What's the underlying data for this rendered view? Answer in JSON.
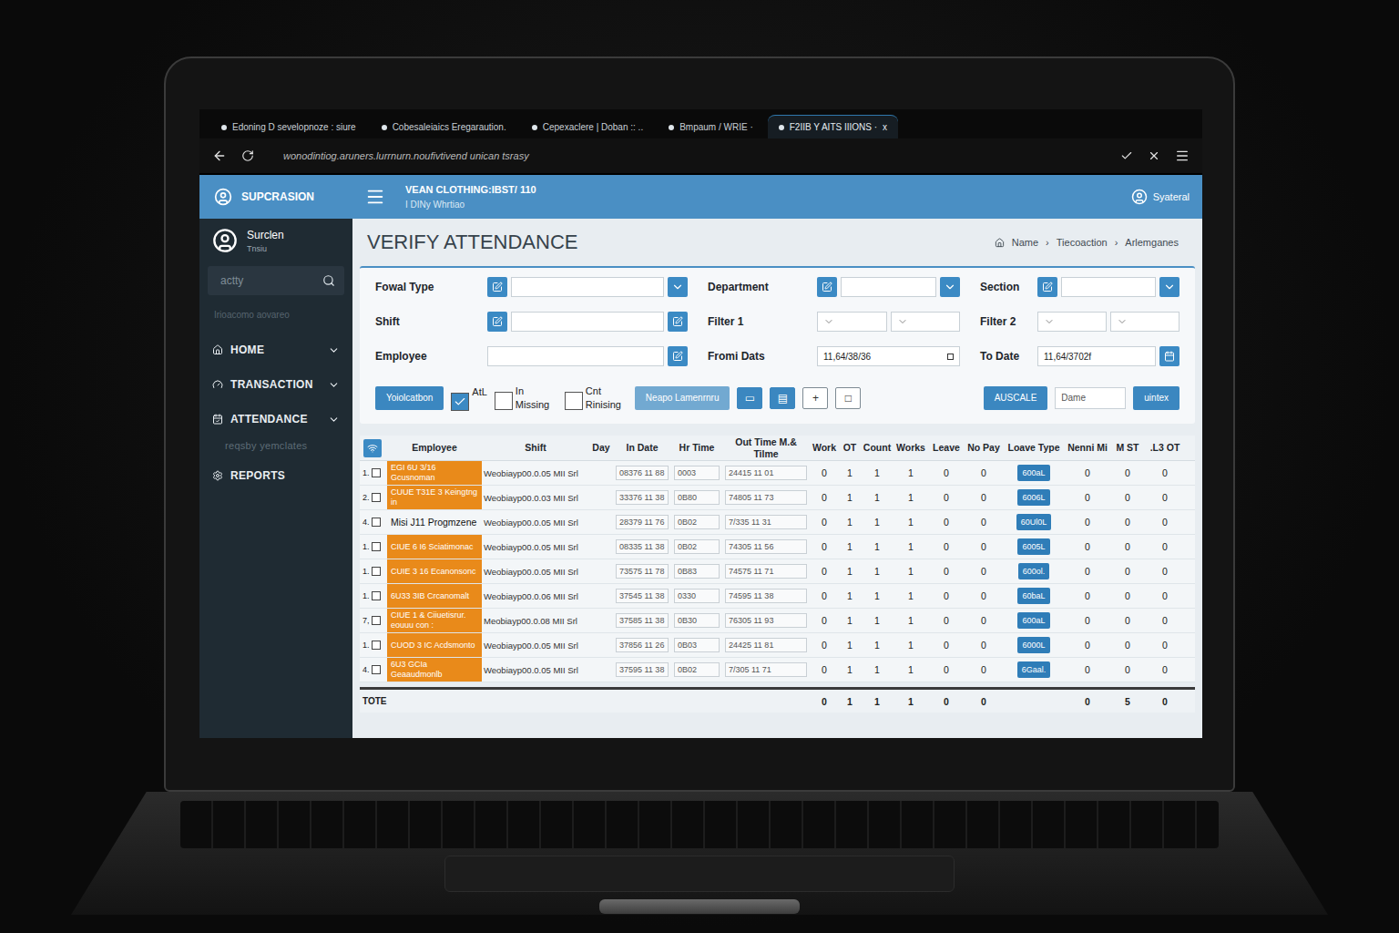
{
  "browser": {
    "tabs": [
      {
        "label": "Edoning D sevelopnoze : siure",
        "selected": false
      },
      {
        "label": "Cobesaleiaics Eregaraution.",
        "selected": false
      },
      {
        "label": "Cepexaclere | Doban :: ..",
        "selected": false
      },
      {
        "label": "Bmpaum / WRIE ·",
        "selected": false
      },
      {
        "label": "F2IIB Y AITS IIIONS ·",
        "selected": true
      }
    ],
    "close": "x",
    "url": "wonodintiog.aruners.lurrnurn.noufivtivend unican tsrasy"
  },
  "sidebar": {
    "brand": "SUPCRASION",
    "user": {
      "name": "Surclen",
      "role": "Tnsiu"
    },
    "search": {
      "placeholder": "actty"
    },
    "section_label": "Irioacomo aovareo",
    "items": [
      {
        "label": "HOME",
        "kind": "group"
      },
      {
        "label": "TRANSACTION",
        "kind": "group"
      },
      {
        "label": "ATTENDANCE",
        "kind": "group"
      },
      {
        "label": "reqsby yemclates",
        "kind": "sub"
      },
      {
        "label": "REPORTS",
        "kind": "link"
      }
    ]
  },
  "header": {
    "company": "VEAN CLOTHING:IBST/ 110",
    "subtitle": "I DINy Whrtiao",
    "user": "Syateral"
  },
  "page": {
    "title": "VERIFY ATTENDANCE",
    "breadcrumb": [
      "Name",
      "Tiecoaction",
      "Arlemganes"
    ],
    "separator": "›"
  },
  "filters": [
    [
      {
        "label": "Fowal Type",
        "kind": "icon-select",
        "values": [
          ""
        ]
      },
      {
        "label": "Department",
        "kind": "icon-select",
        "values": [
          ""
        ]
      },
      {
        "label": "Section",
        "kind": "icon-select",
        "values": [
          ""
        ]
      }
    ],
    [
      {
        "label": "Shift",
        "kind": "icon-input-button",
        "values": [
          ""
        ]
      },
      {
        "label": "Filter 1",
        "kind": "double-select",
        "values": [
          "",
          ""
        ]
      },
      {
        "label": "Filter 2",
        "kind": "double-select",
        "values": [
          "",
          ""
        ]
      }
    ],
    [
      {
        "label": "Employee",
        "kind": "input-button",
        "values": [
          ""
        ]
      },
      {
        "label": "Fromi Dats",
        "kind": "date",
        "values": [
          "11,64/38/36"
        ]
      },
      {
        "label": "To Date",
        "kind": "date-button",
        "values": [
          "11,64/3702f"
        ]
      }
    ]
  ],
  "actions": [
    {
      "kind": "button",
      "label": "Yoiolcatbon",
      "filled": true
    },
    {
      "kind": "checkbox",
      "label": "AtL",
      "checked": true
    },
    {
      "kind": "checkbox",
      "label": "In Missing",
      "checked": false
    },
    {
      "kind": "checkbox",
      "label": "Cnt Rinising",
      "checked": false
    },
    {
      "kind": "button",
      "label": "Neapo Lamenrnru",
      "filled": false
    },
    {
      "kind": "icon-button",
      "label": "▭",
      "filled": true
    },
    {
      "kind": "icon-button",
      "label": "▤",
      "filled": true
    },
    {
      "kind": "icon-button",
      "label": "+",
      "filled": false
    },
    {
      "kind": "icon-button",
      "label": "□",
      "filled": false
    },
    {
      "kind": "spacer",
      "label": ""
    },
    {
      "kind": "button",
      "label": "AUSCALE",
      "filled": true
    },
    {
      "kind": "input",
      "label": "Dame"
    },
    {
      "kind": "button",
      "label": "uintex",
      "filled": true
    }
  ],
  "table": {
    "columns": [
      {
        "label": "Employee",
        "kind": "employee"
      },
      {
        "label": "Shift",
        "kind": "text"
      },
      {
        "label": "Day",
        "kind": "text"
      },
      {
        "label": "In Date",
        "kind": "box"
      },
      {
        "label": "Hr Time",
        "kind": "box"
      },
      {
        "label": "Out Time M.& Tilme",
        "kind": "box"
      },
      {
        "label": "Work",
        "kind": "number"
      },
      {
        "label": "OT",
        "kind": "number"
      },
      {
        "label": "Count",
        "kind": "number"
      },
      {
        "label": "Works",
        "kind": "number"
      },
      {
        "label": "Leave",
        "kind": "number"
      },
      {
        "label": "No Pay",
        "kind": "number"
      },
      {
        "label": "Loave Type",
        "kind": "button"
      },
      {
        "label": "Nenni Mi",
        "kind": "number"
      },
      {
        "label": "M ST",
        "kind": "number"
      },
      {
        "label": ".L3 OT",
        "kind": "number"
      }
    ],
    "rows": [
      {
        "index": "1.",
        "checked": false,
        "highlighted": true,
        "cells": [
          "EGI 6U 3/16 Gcusnoman",
          "Weobiayp00.0.05 MII Srl",
          "",
          "08376 11 88",
          "0003",
          "24415 11 01",
          "0",
          "1",
          "1",
          "1",
          "0",
          "0",
          "600aL",
          "0",
          "0",
          "0"
        ]
      },
      {
        "index": "2.",
        "checked": false,
        "highlighted": true,
        "cells": [
          "CUUE T31E 3 Keingtng in",
          "Weobiayp00.0.03 MII Srl",
          "",
          "33376 11 38",
          "0B80",
          "74805 11 73",
          "0",
          "1",
          "1",
          "1",
          "0",
          "0",
          "6006L",
          "0",
          "0",
          "0"
        ]
      },
      {
        "index": "4.",
        "checked": false,
        "highlighted": false,
        "cells": [
          "Misi J11 Progmzene",
          "Weobiayp00.0.05 MII Srl",
          "",
          "28379 11 76",
          "0B02",
          "7/335 11 31",
          "0",
          "1",
          "1",
          "1",
          "0",
          "0",
          "60Ul0L",
          "0",
          "0",
          "0"
        ]
      },
      {
        "index": "1.",
        "checked": false,
        "highlighted": true,
        "cells": [
          "CIUE 6 I6 Sciatimonac",
          "Weobiayp00.0.05 MII Srl",
          "",
          "08335 11 38",
          "0B02",
          "74305 11 56",
          "0",
          "1",
          "1",
          "1",
          "0",
          "0",
          "6005L",
          "0",
          "0",
          "0"
        ]
      },
      {
        "index": "1.",
        "checked": false,
        "highlighted": true,
        "cells": [
          "CUIE 3 16 Ecanonsonc",
          "Weobiayp00.0.05 MII Srl",
          "",
          "73575 11 78",
          "0B83",
          "74575 11 71",
          "0",
          "1",
          "1",
          "1",
          "0",
          "0",
          "600ol.",
          "0",
          "0",
          "0"
        ]
      },
      {
        "index": "1.",
        "checked": false,
        "highlighted": true,
        "cells": [
          "6U33 3IB Crcanomalt",
          "Weobiayp00.0.06 MII Srl",
          "",
          "37545 11 38",
          "0330",
          "74595 11 38",
          "0",
          "1",
          "1",
          "1",
          "0",
          "0",
          "60baL",
          "0",
          "0",
          "0"
        ]
      },
      {
        "index": "7,",
        "checked": false,
        "highlighted": true,
        "cells": [
          "CIUE 1 & Ciiuetisrur. eouuu con :",
          "Meobiayp00.0.08 MII Srl",
          "",
          "37585 11 38",
          "0B30",
          "76305 11 93",
          "0",
          "1",
          "1",
          "1",
          "0",
          "0",
          "600aL",
          "0",
          "0",
          "0"
        ]
      },
      {
        "index": "1.",
        "checked": false,
        "highlighted": true,
        "cells": [
          "CUOD 3 IC Acdsmonto",
          "Weobiayp00.0.05 MII Srl",
          "",
          "37856 11 26",
          "0B03",
          "24425 11 81",
          "0",
          "1",
          "1",
          "1",
          "0",
          "0",
          "6000L",
          "0",
          "0",
          "0"
        ]
      },
      {
        "index": "4.",
        "checked": false,
        "highlighted": true,
        "cells": [
          "6U3 GCIa Geaaudmonlb",
          "Weobiayp00.0.05 MII Srl",
          "",
          "37595 11 38",
          "0B02",
          "7/305 11 71",
          "0",
          "1",
          "1",
          "1",
          "0",
          "0",
          "6Gaal.",
          "0",
          "0",
          "0"
        ]
      }
    ],
    "total": {
      "label": "TOTE",
      "cells": [
        "",
        "",
        "",
        "",
        "",
        "",
        "0",
        "1",
        "1",
        "1",
        "0",
        "0",
        "",
        "0",
        "5",
        "0"
      ]
    }
  }
}
